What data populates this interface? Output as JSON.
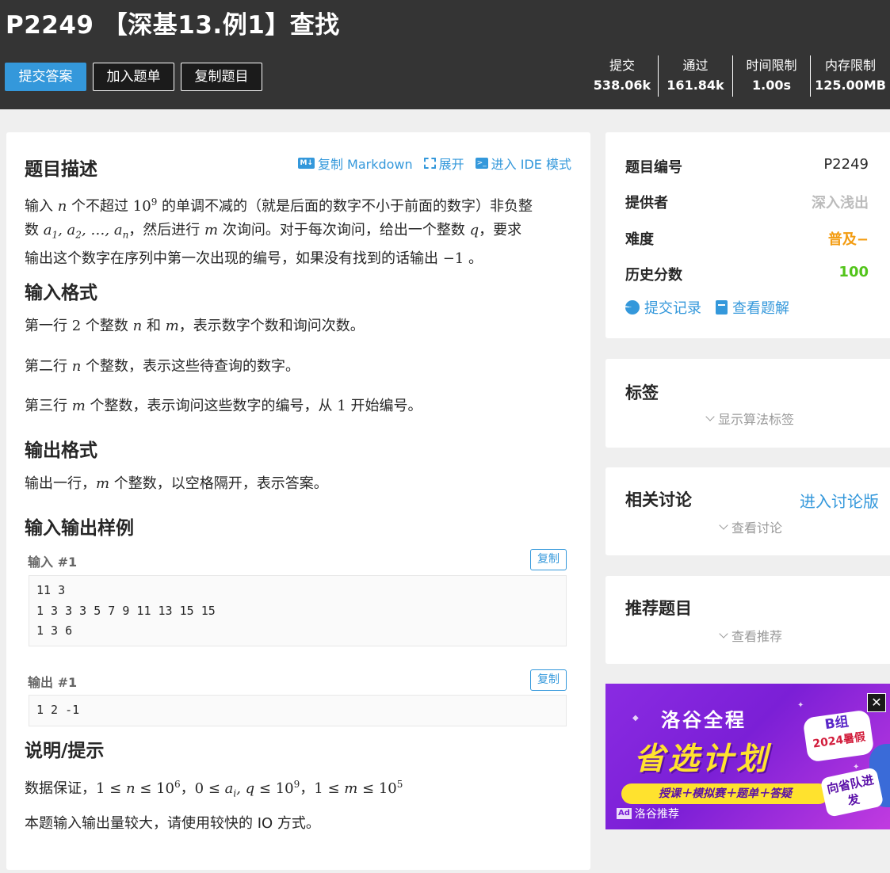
{
  "header": {
    "title": "P2249 【深基13.例1】查找",
    "buttons": {
      "submit": "提交答案",
      "add_list": "加入题单",
      "copy": "复制题目"
    },
    "stats": [
      {
        "label": "提交",
        "value": "538.06k"
      },
      {
        "label": "通过",
        "value": "161.84k"
      },
      {
        "label": "时间限制",
        "value": "1.00s"
      },
      {
        "label": "内存限制",
        "value": "125.00MB"
      }
    ]
  },
  "problem": {
    "tools": {
      "copy_markdown": "复制 Markdown",
      "expand": "展开",
      "ide": "进入 IDE 模式"
    },
    "sections": {
      "description": "题目描述",
      "input_format": "输入格式",
      "output_format": "输出格式",
      "samples": "输入输出样例",
      "hint": "说明/提示"
    },
    "samples": {
      "input_label": "输入 #1",
      "output_label": "输出 #1",
      "copy_label": "复制",
      "input": "11 3\n1 3 3 3 5 7 9 11 13 15 15\n1 3 6",
      "output": "1 2 -1"
    },
    "hint_tail": "本题输入输出量较大，请使用较快的 IO 方式。"
  },
  "sidebar": {
    "info": {
      "rows": [
        {
          "key": "题目编号",
          "value": "P2249",
          "color": "#262626"
        },
        {
          "key": "提供者",
          "value": "深入浅出",
          "color": "#bbbbbb"
        },
        {
          "key": "难度",
          "value": "普及−",
          "color": "#f39c11"
        },
        {
          "key": "历史分数",
          "value": "100",
          "color": "#52c41a"
        }
      ],
      "links": {
        "records": "提交记录",
        "solutions": "查看题解"
      }
    },
    "tags": {
      "title": "标签",
      "toggle": "显示算法标签"
    },
    "discuss": {
      "title": "相关讨论",
      "link": "进入讨论版",
      "toggle": "查看讨论"
    },
    "recommend": {
      "title": "推荐题目",
      "toggle": "查看推荐"
    }
  },
  "ad": {
    "brand": "洛谷全程",
    "headline": "省选计划",
    "badge_top": "B组",
    "badge_bottom": "2024暑假",
    "banner": "授课＋模拟赛＋题单＋答疑",
    "corner": "向省队进发",
    "tag_icon": "Ad",
    "tag": "洛谷推荐",
    "close": "✕"
  },
  "colors": {
    "accent": "#3498db",
    "header_bg": "#343434"
  }
}
